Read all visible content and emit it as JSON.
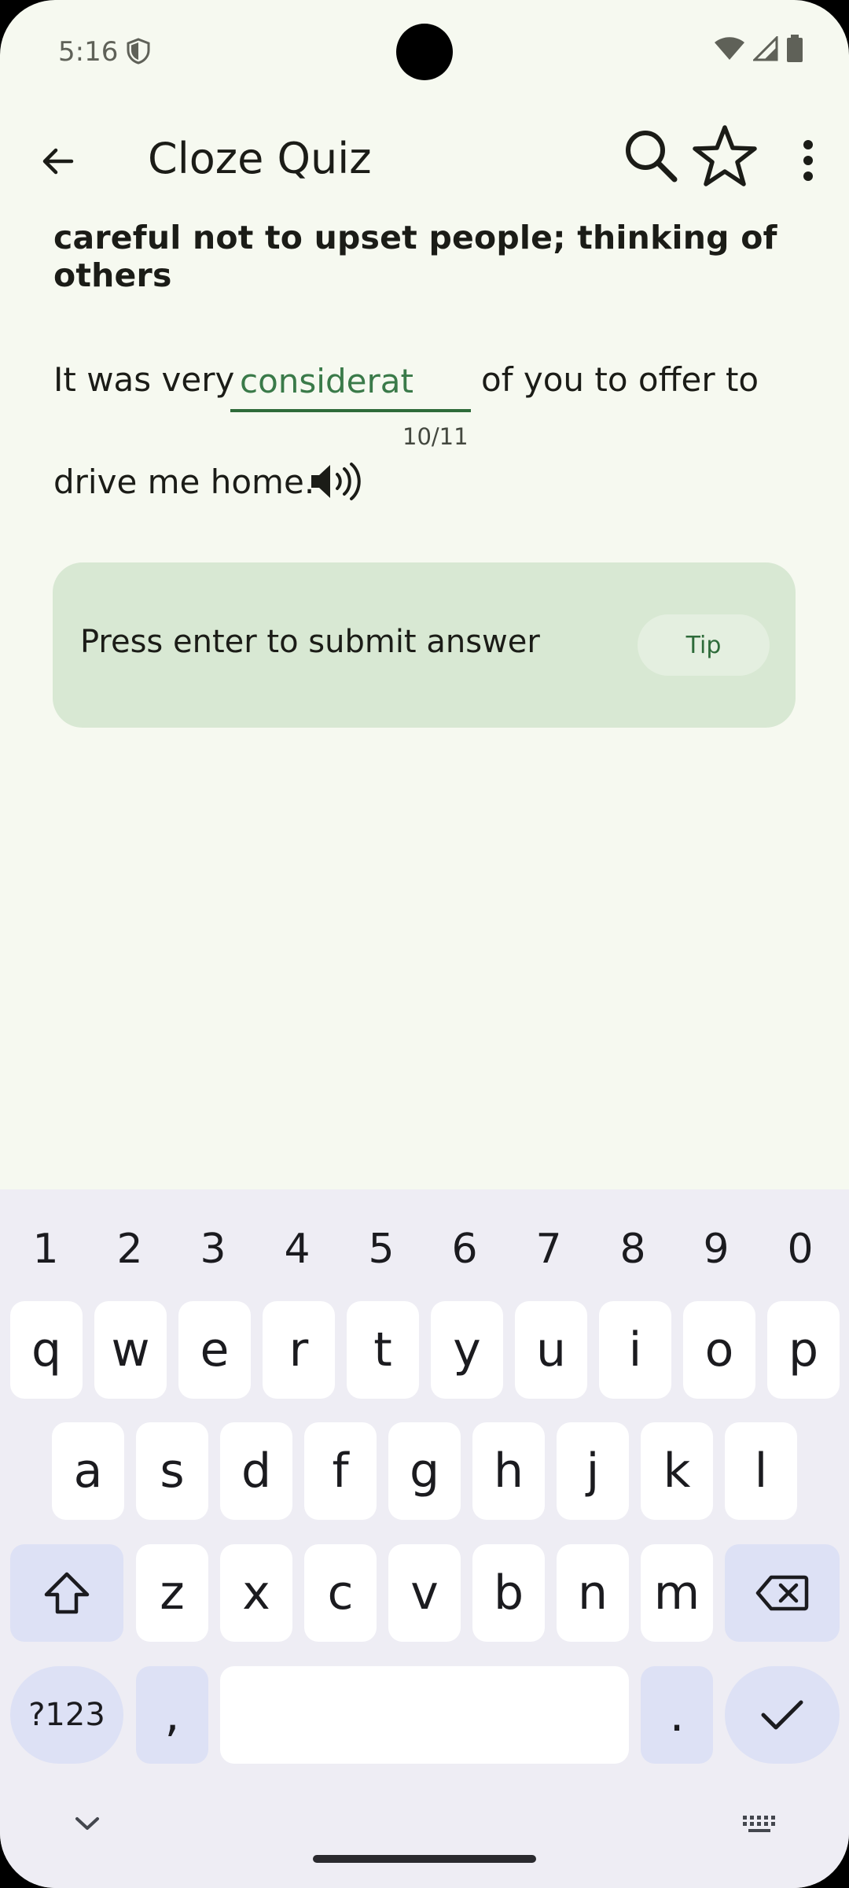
{
  "status_bar": {
    "time": "5:16"
  },
  "app_bar": {
    "title": "Cloze Quiz",
    "back_icon": "arrow-back-icon",
    "search_icon": "search-icon",
    "star_icon": "star-outline-icon",
    "more_icon": "more-vert-icon"
  },
  "quiz": {
    "definition": "careful not to upset people; thinking of others",
    "sentence_before": "It was very",
    "answer_value": "considerat",
    "sentence_after": "of you to offer to",
    "sentence_end": "drive me home.",
    "char_counter": "10/11",
    "speaker_icon": "volume-icon"
  },
  "tip_card": {
    "message": "Press enter to submit answer",
    "button_label": "Tip"
  },
  "keyboard": {
    "numbers": [
      "1",
      "2",
      "3",
      "4",
      "5",
      "6",
      "7",
      "8",
      "9",
      "0"
    ],
    "row1": [
      "q",
      "w",
      "e",
      "r",
      "t",
      "y",
      "u",
      "i",
      "o",
      "p"
    ],
    "row2": [
      "a",
      "s",
      "d",
      "f",
      "g",
      "h",
      "j",
      "k",
      "l"
    ],
    "row3": [
      "z",
      "x",
      "c",
      "v",
      "b",
      "n",
      "m"
    ],
    "symbols_label": "?123",
    "comma_label": ",",
    "period_label": ".",
    "shift_icon": "shift-icon",
    "backspace_icon": "backspace-icon",
    "enter_icon": "check-icon",
    "hide_icon": "chevron-down-icon",
    "keyboard_icon": "keyboard-icon"
  },
  "colors": {
    "background": "#f6f9f0",
    "accent": "#2e6b3a",
    "tip_card": "#d8e8d3",
    "keyboard_bg": "#eeedf4",
    "special_key": "#dde1f5"
  }
}
